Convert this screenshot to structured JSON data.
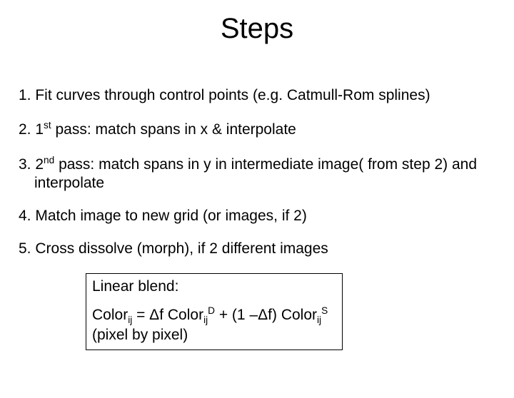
{
  "title": "Steps",
  "items": {
    "i1": {
      "num": "1.",
      "text": "Fit curves through control points (e.g. Catmull-Rom splines)"
    },
    "i2": {
      "num": "2.",
      "prefix": "1",
      "sup": "st",
      "rest": " pass: match spans in x & interpolate"
    },
    "i3": {
      "num": "3.",
      "prefix": "2",
      "sup": "nd",
      "rest": " pass: match spans in y in intermediate image( from step 2) and interpolate"
    },
    "i4": {
      "num": "4.",
      "text": "Match image to new grid (or images, if 2)"
    },
    "i5": {
      "num": "5.",
      "text": "Cross dissolve (morph), if 2 different images"
    }
  },
  "box": {
    "title": "Linear blend:",
    "f": {
      "c": "Color",
      "ij": "ij",
      "eq": " = Δf ",
      "d": "D",
      "plus": " + (1 –Δf) ",
      "s": "S",
      "tail": "(pixel by pixel)"
    }
  }
}
